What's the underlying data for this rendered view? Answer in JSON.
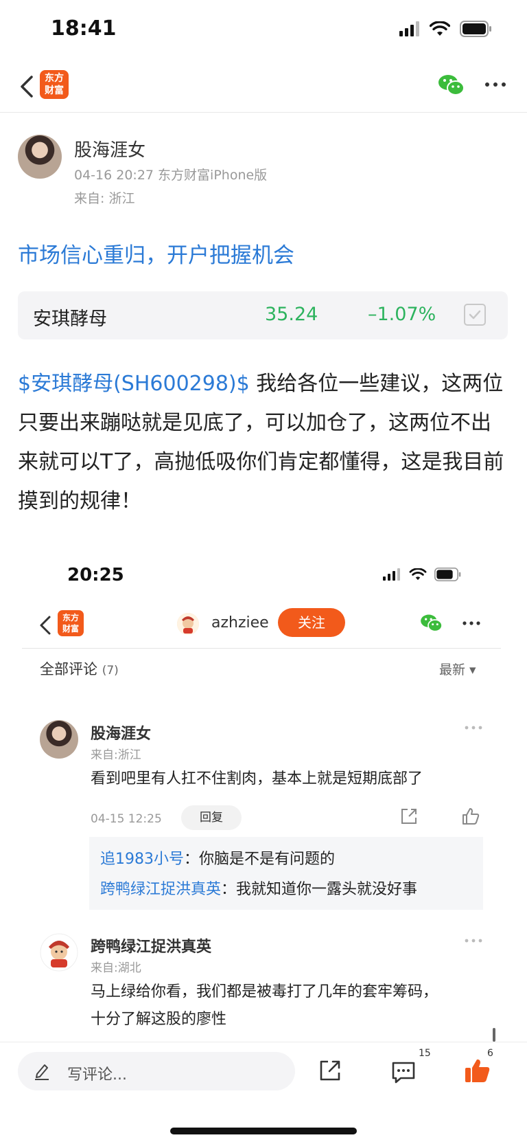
{
  "status_bar": {
    "time": "18:41"
  },
  "nav": {
    "logo_line1": "东方",
    "logo_line2": "财富"
  },
  "author": {
    "name": "股海涯女",
    "meta": "04-16 20:27 东方财富iPhone版",
    "from": "来自: 浙江"
  },
  "post": {
    "title": "市场信心重归，开户把握机会",
    "body_stock": "$安琪酵母(SH600298)$",
    "body_text": " 我给各位一些建议，这两位只要出来蹦哒就是见底了，可以加仓了，这两位不出来就可以T了，高抛低吸你们肯定都懂得，这是我目前摸到的规律！"
  },
  "stock_card": {
    "name": "安琪酵母",
    "price": "35.24",
    "change": "–1.07%",
    "price_color": "#2db35e"
  },
  "embedded": {
    "status_time": "20:25",
    "logo_line1": "东方",
    "logo_line2": "财富",
    "username": "azhziee",
    "follow_label": "关注",
    "comments_label": "全部评论",
    "comments_count": "(7)",
    "sort_label": "最新 ▾",
    "comments": [
      {
        "name": "股海涯女",
        "from": "来自:浙江",
        "text": "看到吧里有人扛不住割肉，基本上就是短期底部了",
        "time": "04-15 12:25",
        "reply_label": "回复"
      },
      {
        "name": "跨鸭绿江捉洪真英",
        "from": "来自:湖北",
        "text_line1": "马上绿给你看，我们都是被毒打了几年的套牢筹码，",
        "text_line2": "十分了解这股的廖性"
      }
    ],
    "sub_replies": [
      {
        "name": "追1983小号",
        "sep": "：",
        "text": "你脑是不是有问题的"
      },
      {
        "name": "跨鸭绿江捉洪真英",
        "sep": "：",
        "text": "我就知道你一露头就没好事"
      }
    ]
  },
  "bottom_bar": {
    "comment_placeholder": "写评论...",
    "comment_count": "15",
    "like_count": "6"
  },
  "colors": {
    "accent": "#f25a1b",
    "link": "#2b7ad6",
    "down": "#2db35e"
  }
}
